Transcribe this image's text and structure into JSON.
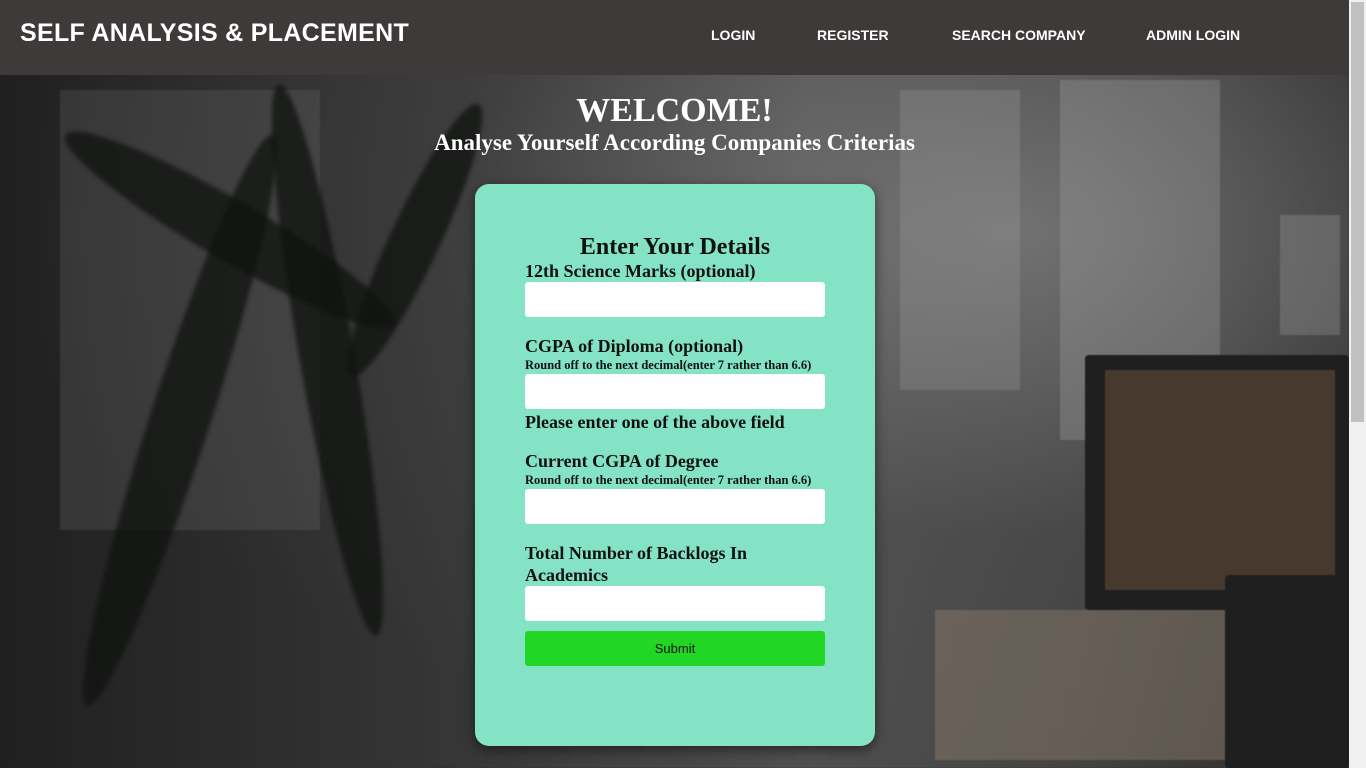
{
  "navbar": {
    "brand": "SELF ANALYSIS & PLACEMENT",
    "links": [
      {
        "label": "LOGIN"
      },
      {
        "label": "REGISTER"
      },
      {
        "label": "SEARCH COMPANY"
      },
      {
        "label": "ADMIN LOGIN"
      }
    ]
  },
  "hero": {
    "title": "WELCOME!",
    "subtitle": "Analyse Yourself According Companies Criterias"
  },
  "form": {
    "title": "Enter Your Details",
    "fields": [
      {
        "label": "12th Science Marks (optional)",
        "hint": "",
        "value": "",
        "placeholder": ""
      },
      {
        "label": "CGPA of Diploma (optional)",
        "hint": "Round off to the next decimal(enter 7 rather than 6.6)",
        "value": "",
        "placeholder": ""
      },
      {
        "label": "Current CGPA of Degree",
        "hint": "Round off to the next decimal(enter 7 rather than 6.6)",
        "value": "",
        "placeholder": ""
      },
      {
        "label": "Total Number of Backlogs In Academics",
        "hint": "",
        "value": "",
        "placeholder": ""
      }
    ],
    "note": "Please enter one of the above field",
    "submit_label": "Submit"
  },
  "colors": {
    "navbar": "#3f3a3a",
    "card": "#84e3c5",
    "submit": "#22d724"
  }
}
